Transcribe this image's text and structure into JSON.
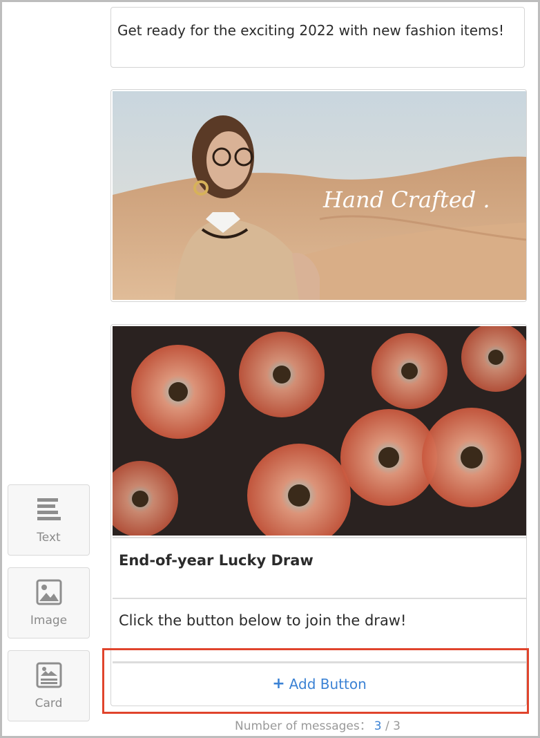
{
  "sidebar": {
    "tools": [
      {
        "label": "Text",
        "icon": "text-lines-icon"
      },
      {
        "label": "Image",
        "icon": "image-icon"
      },
      {
        "label": "Card",
        "icon": "card-icon"
      }
    ]
  },
  "messages": {
    "text_message": "Get ready for the exciting 2022 with new fashion items!",
    "image_message": {
      "overlay_text": "Hand Crafted ."
    },
    "card_message": {
      "title": "End-of-year Lucky Draw",
      "description": "Click the button below to join the draw!",
      "add_button_label": "Add Button",
      "add_button_icon": "plus-icon"
    }
  },
  "footer": {
    "counter_label": "Number of messages：",
    "current": "3",
    "separator": "/",
    "total": "3"
  },
  "colors": {
    "accent": "#3b82d4",
    "highlight_border": "#e0442c"
  }
}
